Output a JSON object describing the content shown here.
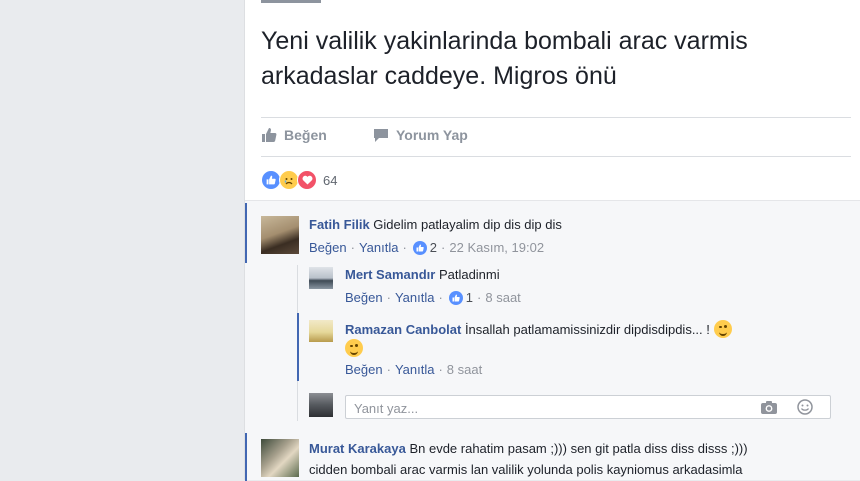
{
  "post": {
    "text_line1": "Yeni valilik yakinlarinda bombali arac varmis",
    "text_line2": "arkadaslar caddeye. Migros önü"
  },
  "actions": {
    "like_label": "Beğen",
    "comment_label": "Yorum Yap"
  },
  "reactions": {
    "count": "64",
    "types": [
      "like-icon",
      "sad-icon",
      "love-icon"
    ]
  },
  "colors": {
    "link": "#385898",
    "fb_blue": "#4267b2",
    "like_blue": "#5890ff",
    "love_red": "#f25268"
  },
  "comments": [
    {
      "author": "Fatih Filik",
      "text": "Gidelim patlayalim dip dis dip dis",
      "like": "Beğen",
      "reply": "Yanıtla",
      "likes": "2",
      "time": "22 Kasım, 19:02",
      "replies": [
        {
          "author": "Mert Samandır",
          "text": "Patladinmi",
          "like": "Beğen",
          "reply": "Yanıtla",
          "likes": "1",
          "time": "8 saat"
        },
        {
          "author": "Ramazan Canbolat",
          "text": "İnsallah patlamamissinizdir dipdisdipdis... !",
          "like": "Beğen",
          "reply": "Yanıtla",
          "time": "8 saat"
        }
      ],
      "reply_placeholder": "Yanıt yaz..."
    },
    {
      "author": "Murat Karakaya",
      "text": "Bn evde rahatim pasam ;))) sen git patla diss diss disss ;)))",
      "text2": "cidden bombali arac varmis lan valilik yolunda polis kayniomus arkadasimla"
    }
  ]
}
